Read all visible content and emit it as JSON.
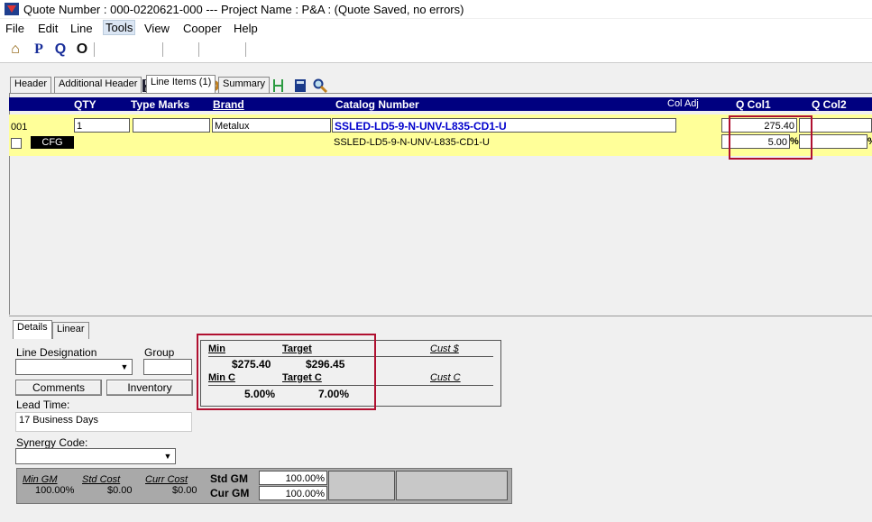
{
  "window": {
    "title": "Quote Number : 000-0220621-000 --- Project Name : P&A : (Quote Saved, no errors)"
  },
  "menu": [
    "File",
    "Edit",
    "Line",
    "Tools",
    "View",
    "Cooper",
    "Help"
  ],
  "toolbar": {
    "home": "⌂",
    "p": "P",
    "q": "Q",
    "o": "O"
  },
  "tabs": [
    "Header",
    "Additional Header",
    "Line Items (1)",
    "Summary"
  ],
  "grid": {
    "headers": {
      "qty": "QTY",
      "type_marks": "Type Marks",
      "brand": "Brand",
      "catalog": "Catalog Number",
      "col_adj": "Col Adj",
      "qcol1": "Q Col1",
      "qcol2": "Q Col2"
    },
    "row": {
      "line": "001",
      "qty": "1",
      "brand": "Metalux",
      "catalog": "SSLED-LD5-9-N-UNV-L835-CD1-U",
      "catalog_sub": "SSLED-LD5-9-N-UNV-L835-CD1-U",
      "cfg": "CFG",
      "qcol1_price": "275.40",
      "qcol1_pct": "5.00",
      "pct_sign": "%"
    }
  },
  "detail_tabs": [
    "Details",
    "Linear"
  ],
  "details": {
    "line_designation": "Line Designation",
    "group": "Group",
    "comments": "Comments",
    "inventory": "Inventory",
    "lead_time_label": "Lead Time:",
    "lead_time_value": "17 Business Days",
    "synergy_label": "Synergy Code:"
  },
  "pricing": {
    "min_label": "Min",
    "target_label": "Target",
    "cust_dollar_label": "Cust $",
    "min_value": "$275.40",
    "target_value": "$296.45",
    "minc_label": "Min C",
    "targetc_label": "Target C",
    "custc_label": "Cust C",
    "minc_value": "5.00%",
    "targetc_value": "7.00%"
  },
  "gm": {
    "min_gm_label": "Min GM",
    "min_gm_value": "100.00%",
    "std_cost_label": "Std Cost",
    "std_cost_value": "$0.00",
    "curr_cost_label": "Curr Cost",
    "curr_cost_value": "$0.00",
    "std_gm_label": "Std GM",
    "std_gm_value": "100.00%",
    "cur_gm_label": "Cur GM",
    "cur_gm_value": "100.00%"
  },
  "colors": {
    "header_bg": "#000080",
    "row_bg": "#ffff99",
    "highlight": "#b01030",
    "catalog_text": "#0000cc"
  }
}
